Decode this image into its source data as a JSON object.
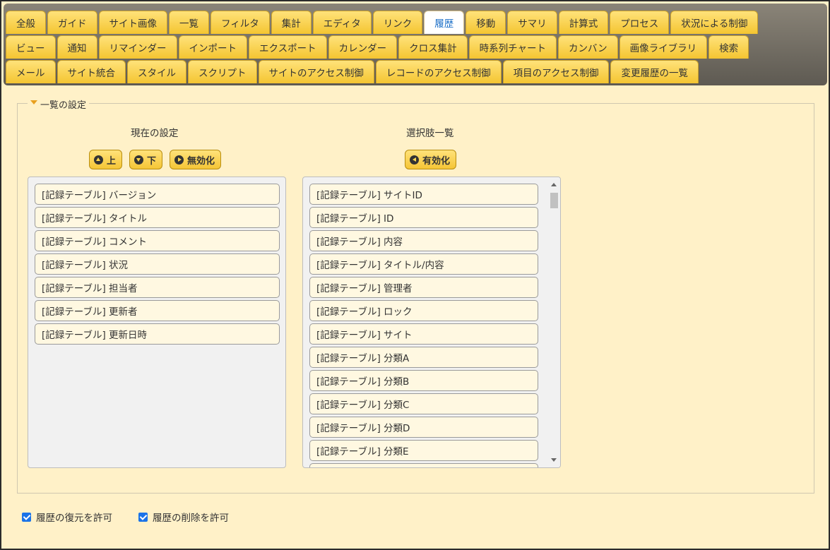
{
  "tabs": {
    "row1": [
      "全般",
      "ガイド",
      "サイト画像",
      "一覧",
      "フィルタ",
      "集計",
      "エディタ",
      "リンク",
      "履歴",
      "移動",
      "サマリ",
      "計算式",
      "プロセス",
      "状況による制御"
    ],
    "row2": [
      "ビュー",
      "通知",
      "リマインダー",
      "インポート",
      "エクスポート",
      "カレンダー",
      "クロス集計",
      "時系列チャート",
      "カンバン",
      "画像ライブラリ",
      "検索"
    ],
    "row3": [
      "メール",
      "サイト統合",
      "スタイル",
      "スクリプト",
      "サイトのアクセス制御",
      "レコードのアクセス制御",
      "項目のアクセス制御",
      "変更履歴の一覧"
    ],
    "active": "履歴"
  },
  "fieldset": {
    "legend": "一覧の設定"
  },
  "current": {
    "title": "現在の設定",
    "btn_up": "上",
    "btn_down": "下",
    "btn_disable": "無効化",
    "items": [
      "[記録テーブル] バージョン",
      "[記録テーブル] タイトル",
      "[記録テーブル] コメント",
      "[記録テーブル] 状況",
      "[記録テーブル] 担当者",
      "[記録テーブル] 更新者",
      "[記録テーブル] 更新日時"
    ]
  },
  "options": {
    "title": "選択肢一覧",
    "btn_enable": "有効化",
    "items": [
      "[記録テーブル] サイトID",
      "[記録テーブル] ID",
      "[記録テーブル] 内容",
      "[記録テーブル] タイトル/内容",
      "[記録テーブル] 管理者",
      "[記録テーブル] ロック",
      "[記録テーブル] サイト",
      "[記録テーブル] 分類A",
      "[記録テーブル] 分類B",
      "[記録テーブル] 分類C",
      "[記録テーブル] 分類D",
      "[記録テーブル] 分類E",
      ""
    ]
  },
  "checks": {
    "allow_restore": "履歴の復元を許可",
    "allow_delete": "履歴の削除を許可"
  },
  "colors": {
    "accent": "#f4c531",
    "background": "#fff1c8",
    "checkbox": "#1a73e8"
  }
}
